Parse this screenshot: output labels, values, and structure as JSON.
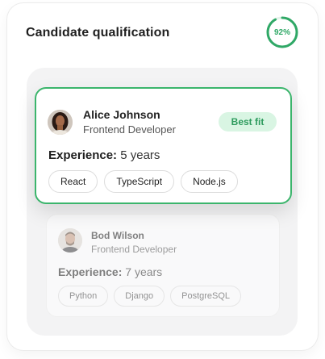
{
  "card": {
    "title": "Candidate qualification",
    "score_label": "92%",
    "score_fraction": 0.92,
    "accent_color": "#2fa866"
  },
  "candidates": [
    {
      "name": "Alice Johnson",
      "role": "Frontend Developer",
      "badge": "Best fit",
      "experience_label": "Experience:",
      "experience_value": "5 years",
      "skills": [
        "React",
        "TypeScript",
        "Node.js"
      ],
      "avatar_icon": "woman-portrait"
    },
    {
      "name": "Bod Wilson",
      "role": "Frontend Developer",
      "experience_label": "Experience:",
      "experience_value": "7 years",
      "skills": [
        "Python",
        "Django",
        "PostgreSQL"
      ],
      "avatar_icon": "man-portrait"
    }
  ]
}
